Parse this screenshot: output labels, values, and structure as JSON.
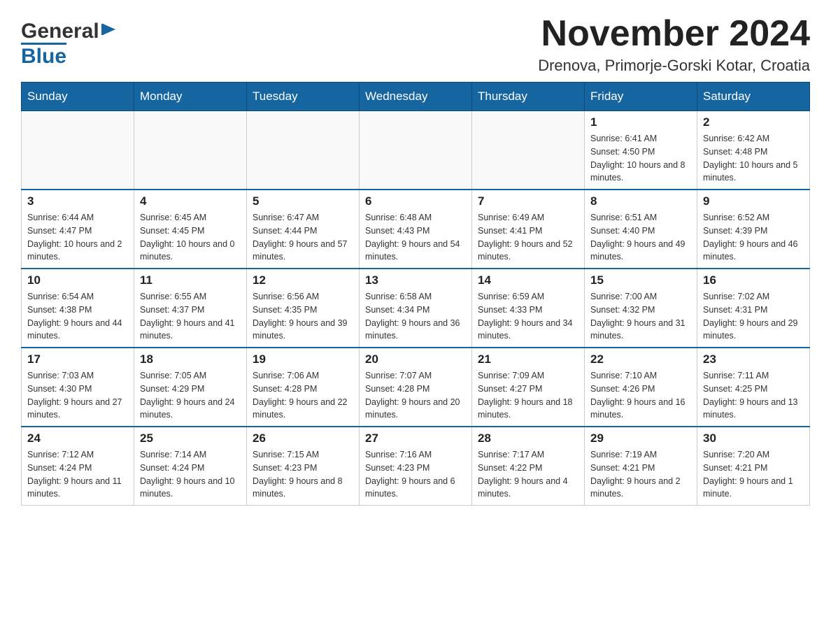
{
  "header": {
    "title": "November 2024",
    "subtitle": "Drenova, Primorje-Gorski Kotar, Croatia",
    "logo_general": "General",
    "logo_blue": "Blue"
  },
  "weekdays": [
    "Sunday",
    "Monday",
    "Tuesday",
    "Wednesday",
    "Thursday",
    "Friday",
    "Saturday"
  ],
  "weeks": [
    [
      {
        "day": "",
        "info": ""
      },
      {
        "day": "",
        "info": ""
      },
      {
        "day": "",
        "info": ""
      },
      {
        "day": "",
        "info": ""
      },
      {
        "day": "",
        "info": ""
      },
      {
        "day": "1",
        "info": "Sunrise: 6:41 AM\nSunset: 4:50 PM\nDaylight: 10 hours and 8 minutes."
      },
      {
        "day": "2",
        "info": "Sunrise: 6:42 AM\nSunset: 4:48 PM\nDaylight: 10 hours and 5 minutes."
      }
    ],
    [
      {
        "day": "3",
        "info": "Sunrise: 6:44 AM\nSunset: 4:47 PM\nDaylight: 10 hours and 2 minutes."
      },
      {
        "day": "4",
        "info": "Sunrise: 6:45 AM\nSunset: 4:45 PM\nDaylight: 10 hours and 0 minutes."
      },
      {
        "day": "5",
        "info": "Sunrise: 6:47 AM\nSunset: 4:44 PM\nDaylight: 9 hours and 57 minutes."
      },
      {
        "day": "6",
        "info": "Sunrise: 6:48 AM\nSunset: 4:43 PM\nDaylight: 9 hours and 54 minutes."
      },
      {
        "day": "7",
        "info": "Sunrise: 6:49 AM\nSunset: 4:41 PM\nDaylight: 9 hours and 52 minutes."
      },
      {
        "day": "8",
        "info": "Sunrise: 6:51 AM\nSunset: 4:40 PM\nDaylight: 9 hours and 49 minutes."
      },
      {
        "day": "9",
        "info": "Sunrise: 6:52 AM\nSunset: 4:39 PM\nDaylight: 9 hours and 46 minutes."
      }
    ],
    [
      {
        "day": "10",
        "info": "Sunrise: 6:54 AM\nSunset: 4:38 PM\nDaylight: 9 hours and 44 minutes."
      },
      {
        "day": "11",
        "info": "Sunrise: 6:55 AM\nSunset: 4:37 PM\nDaylight: 9 hours and 41 minutes."
      },
      {
        "day": "12",
        "info": "Sunrise: 6:56 AM\nSunset: 4:35 PM\nDaylight: 9 hours and 39 minutes."
      },
      {
        "day": "13",
        "info": "Sunrise: 6:58 AM\nSunset: 4:34 PM\nDaylight: 9 hours and 36 minutes."
      },
      {
        "day": "14",
        "info": "Sunrise: 6:59 AM\nSunset: 4:33 PM\nDaylight: 9 hours and 34 minutes."
      },
      {
        "day": "15",
        "info": "Sunrise: 7:00 AM\nSunset: 4:32 PM\nDaylight: 9 hours and 31 minutes."
      },
      {
        "day": "16",
        "info": "Sunrise: 7:02 AM\nSunset: 4:31 PM\nDaylight: 9 hours and 29 minutes."
      }
    ],
    [
      {
        "day": "17",
        "info": "Sunrise: 7:03 AM\nSunset: 4:30 PM\nDaylight: 9 hours and 27 minutes."
      },
      {
        "day": "18",
        "info": "Sunrise: 7:05 AM\nSunset: 4:29 PM\nDaylight: 9 hours and 24 minutes."
      },
      {
        "day": "19",
        "info": "Sunrise: 7:06 AM\nSunset: 4:28 PM\nDaylight: 9 hours and 22 minutes."
      },
      {
        "day": "20",
        "info": "Sunrise: 7:07 AM\nSunset: 4:28 PM\nDaylight: 9 hours and 20 minutes."
      },
      {
        "day": "21",
        "info": "Sunrise: 7:09 AM\nSunset: 4:27 PM\nDaylight: 9 hours and 18 minutes."
      },
      {
        "day": "22",
        "info": "Sunrise: 7:10 AM\nSunset: 4:26 PM\nDaylight: 9 hours and 16 minutes."
      },
      {
        "day": "23",
        "info": "Sunrise: 7:11 AM\nSunset: 4:25 PM\nDaylight: 9 hours and 13 minutes."
      }
    ],
    [
      {
        "day": "24",
        "info": "Sunrise: 7:12 AM\nSunset: 4:24 PM\nDaylight: 9 hours and 11 minutes."
      },
      {
        "day": "25",
        "info": "Sunrise: 7:14 AM\nSunset: 4:24 PM\nDaylight: 9 hours and 10 minutes."
      },
      {
        "day": "26",
        "info": "Sunrise: 7:15 AM\nSunset: 4:23 PM\nDaylight: 9 hours and 8 minutes."
      },
      {
        "day": "27",
        "info": "Sunrise: 7:16 AM\nSunset: 4:23 PM\nDaylight: 9 hours and 6 minutes."
      },
      {
        "day": "28",
        "info": "Sunrise: 7:17 AM\nSunset: 4:22 PM\nDaylight: 9 hours and 4 minutes."
      },
      {
        "day": "29",
        "info": "Sunrise: 7:19 AM\nSunset: 4:21 PM\nDaylight: 9 hours and 2 minutes."
      },
      {
        "day": "30",
        "info": "Sunrise: 7:20 AM\nSunset: 4:21 PM\nDaylight: 9 hours and 1 minute."
      }
    ]
  ]
}
